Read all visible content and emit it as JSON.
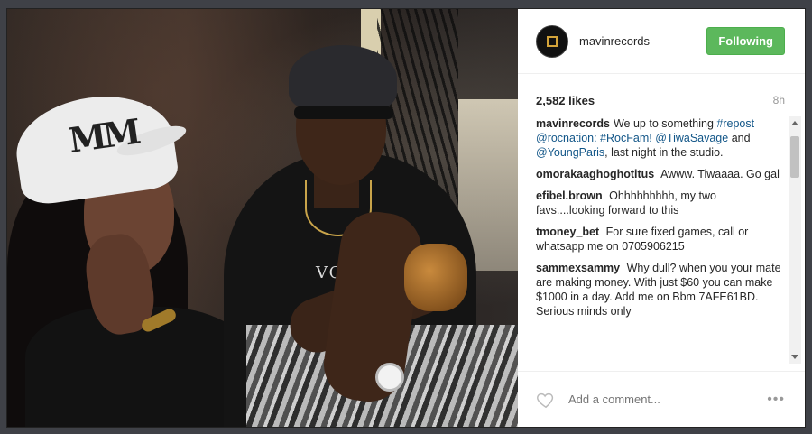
{
  "post": {
    "username": "mavinrecords",
    "follow_label": "Following",
    "likes": "2,582 likes",
    "age": "8h",
    "photo_print": "VO",
    "logo_text": "MM",
    "comments": [
      {
        "user": "mavinrecords",
        "parts": [
          "We up to something ",
          "#repost @rocnation: #RocFam!",
          " ",
          "@TiwaSavage",
          " and ",
          "@YoungParis",
          ", last night in the studio."
        ]
      },
      {
        "user": "omorakaaghoghotitus",
        "text": "Awww. Tiwaaaa. Go gal"
      },
      {
        "user": "efibel.brown",
        "text": "Ohhhhhhhhh, my two favs....looking forward to this"
      },
      {
        "user": "tmoney_bet",
        "text": "For sure fixed games, call or whatsapp me on 0705906215"
      },
      {
        "user": "sammexsammy",
        "text": "Why dull? when you your mate are making money. With just $60 you can make $1000 in a day. Add me on Bbm 7AFE61BD. Serious minds only"
      }
    ],
    "comment_placeholder": "Add a comment...",
    "more_label": "•••"
  },
  "icons": {
    "heart": "heart-icon",
    "more": "more-options-icon",
    "avatar": "mavin-logo"
  },
  "colors": {
    "follow": "#5cb85c",
    "link": "#125688"
  }
}
